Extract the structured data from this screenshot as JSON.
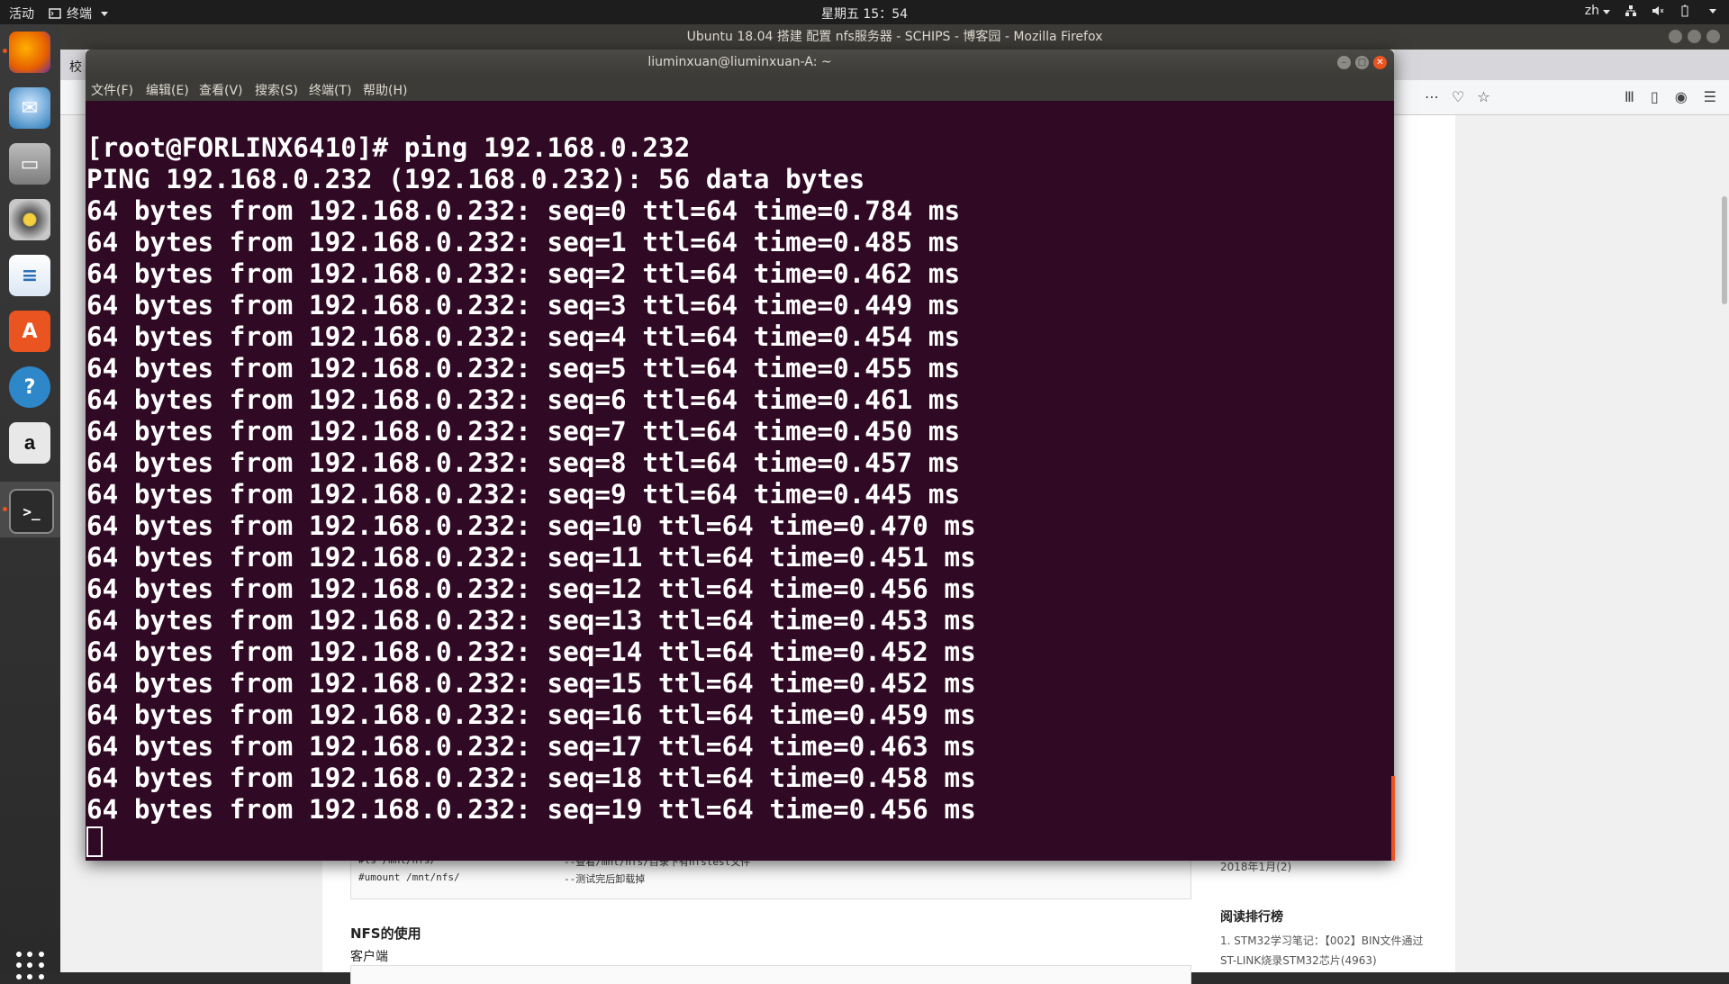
{
  "topbar": {
    "activities": "活动",
    "app_name": "终端",
    "clock": "星期五 15：54",
    "lang": "zh"
  },
  "firefox": {
    "window_title": "Ubuntu 18.04 搭建 配置 nfs服务器 - SCHIPS - 博客园 - Mozilla Firefox",
    "tab_label": "校",
    "page": {
      "code_lines": [
        {
          "cmd": "#ls /mnt/nfs/",
          "comment": "--查看/mnt/nfs/目录下有nfstest文件"
        },
        {
          "cmd": "#umount /mnt/nfs/",
          "comment": "--测试完后卸载掉"
        }
      ],
      "heading": "NFS的使用",
      "subheading": "客户端",
      "sidebar_date": "2018年1月(2)",
      "sidebar_title": "阅读排行榜",
      "sidebar_item_line1": "1. STM32学习笔记：【002】BIN文件通过",
      "sidebar_item_line2": "ST-LINK烧录STM32芯片(4963)"
    }
  },
  "terminal": {
    "title": "liuminxuan@liuminxuan-A: ~",
    "menu": [
      "文件(F)",
      "编辑(E)",
      "查看(V)",
      "搜索(S)",
      "终端(T)",
      "帮助(H)"
    ],
    "lines": [
      "[root@FORLINX6410]# ping 192.168.0.232",
      "PING 192.168.0.232 (192.168.0.232): 56 data bytes",
      "64 bytes from 192.168.0.232: seq=0 ttl=64 time=0.784 ms",
      "64 bytes from 192.168.0.232: seq=1 ttl=64 time=0.485 ms",
      "64 bytes from 192.168.0.232: seq=2 ttl=64 time=0.462 ms",
      "64 bytes from 192.168.0.232: seq=3 ttl=64 time=0.449 ms",
      "64 bytes from 192.168.0.232: seq=4 ttl=64 time=0.454 ms",
      "64 bytes from 192.168.0.232: seq=5 ttl=64 time=0.455 ms",
      "64 bytes from 192.168.0.232: seq=6 ttl=64 time=0.461 ms",
      "64 bytes from 192.168.0.232: seq=7 ttl=64 time=0.450 ms",
      "64 bytes from 192.168.0.232: seq=8 ttl=64 time=0.457 ms",
      "64 bytes from 192.168.0.232: seq=9 ttl=64 time=0.445 ms",
      "64 bytes from 192.168.0.232: seq=10 ttl=64 time=0.470 ms",
      "64 bytes from 192.168.0.232: seq=11 ttl=64 time=0.451 ms",
      "64 bytes from 192.168.0.232: seq=12 ttl=64 time=0.456 ms",
      "64 bytes from 192.168.0.232: seq=13 ttl=64 time=0.453 ms",
      "64 bytes from 192.168.0.232: seq=14 ttl=64 time=0.452 ms",
      "64 bytes from 192.168.0.232: seq=15 ttl=64 time=0.452 ms",
      "64 bytes from 192.168.0.232: seq=16 ttl=64 time=0.459 ms",
      "64 bytes from 192.168.0.232: seq=17 ttl=64 time=0.463 ms",
      "64 bytes from 192.168.0.232: seq=18 ttl=64 time=0.458 ms",
      "64 bytes from 192.168.0.232: seq=19 ttl=64 time=0.456 ms"
    ],
    "colors": {
      "background": "#300a24",
      "foreground": "#ffffff",
      "accent": "#e95420"
    }
  },
  "dock": {
    "items": [
      {
        "name": "firefox-icon",
        "glyph": "",
        "color": "#e66000"
      },
      {
        "name": "thunderbird-icon",
        "glyph": "",
        "color": "#2a7ab8"
      },
      {
        "name": "files-icon",
        "glyph": "",
        "color": "#8a8a8a"
      },
      {
        "name": "rhythmbox-icon",
        "glyph": "",
        "color": "#d9a400"
      },
      {
        "name": "libreoffice-writer-icon",
        "glyph": "",
        "color": "#2a6fb8"
      },
      {
        "name": "software-center-icon",
        "glyph": "A",
        "color": "#e95420"
      },
      {
        "name": "help-icon",
        "glyph": "?",
        "color": "#2e87c9"
      },
      {
        "name": "amazon-icon",
        "glyph": "a",
        "color": "#e8e8e8"
      },
      {
        "name": "terminal-icon",
        "glyph": ">_",
        "color": "#2b2b2b"
      }
    ]
  }
}
